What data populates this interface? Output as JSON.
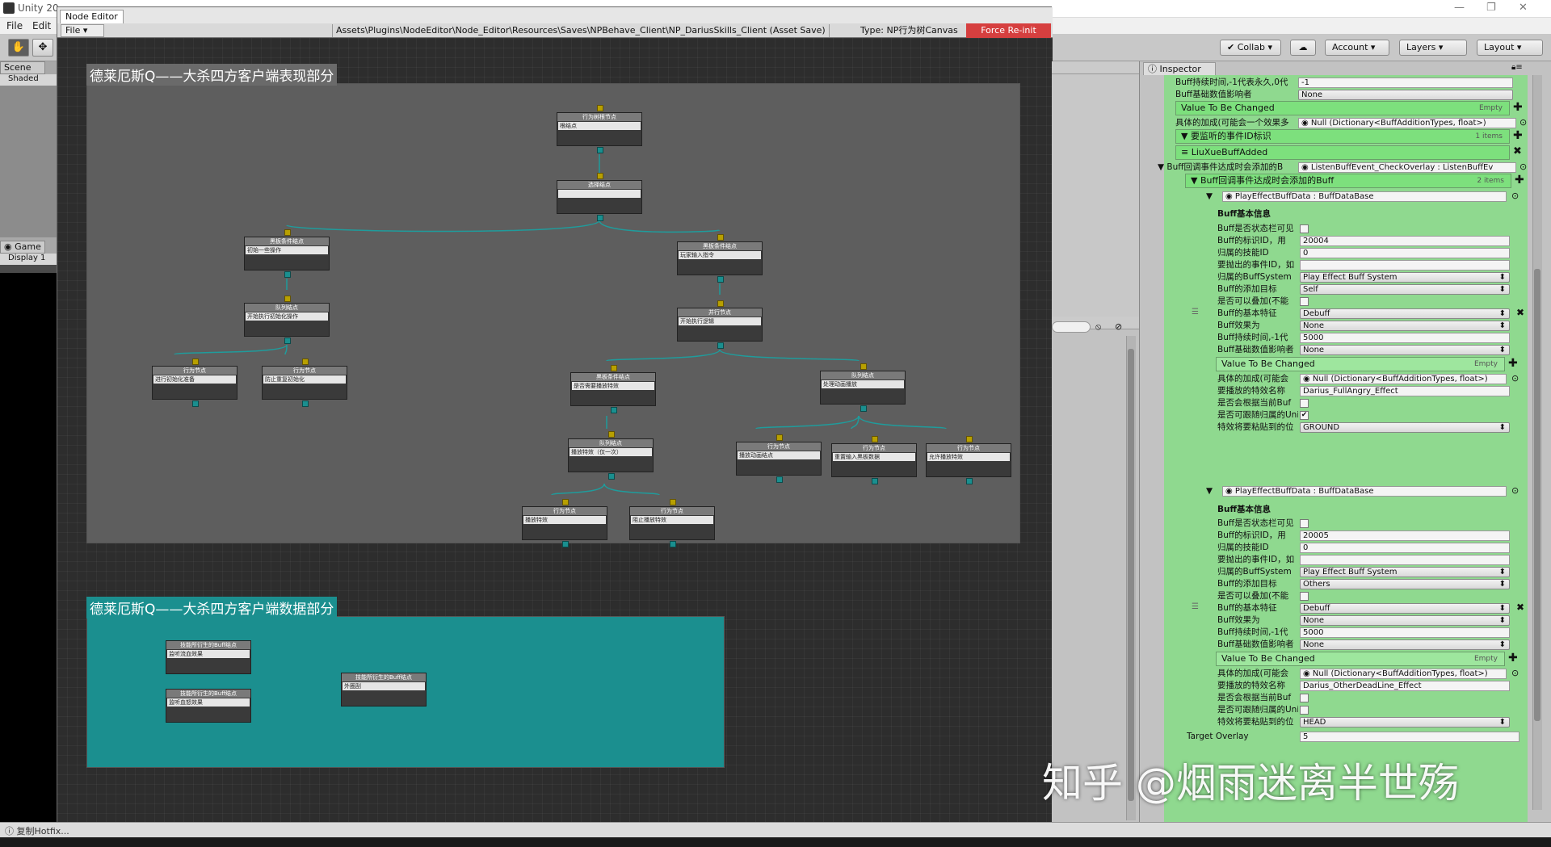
{
  "app": {
    "title": "Unity 20",
    "menu": [
      "File",
      "Edit"
    ]
  },
  "toolbar": {
    "collab": "Collab",
    "account": "Account",
    "layers": "Layers",
    "layout": "Layout"
  },
  "left": {
    "scene": "Scene",
    "shaded": "Shaded",
    "game": "Game",
    "display": "Display 1"
  },
  "editor": {
    "tab": "Node Editor",
    "file": "File",
    "path": "Assets\\Plugins\\NodeEditor\\Node_Editor\\Resources\\Saves\\NPBehave_Client\\NP_DariusSkills_Client (Asset Save)",
    "type": "Type: NP行为树Canvas",
    "force": "Force Re-init",
    "group1": "德莱厄斯Q——大杀四方客户端表现部分",
    "group2": "德莱厄斯Q——大杀四方客户端数据部分",
    "nodes": [
      {
        "h": "行为树根节点",
        "f": "根结点"
      },
      {
        "h": "选择结点",
        "f": ""
      },
      {
        "h": "黑板条件结点",
        "f": "初始一些操作"
      },
      {
        "h": "黑板条件结点",
        "f": "玩家输入指令"
      },
      {
        "h": "队列结点",
        "f": "开始执行初始化操作"
      },
      {
        "h": "并行节点",
        "f": "开始执行逻辑"
      },
      {
        "h": "行为节点",
        "f": "进行初始化准备"
      },
      {
        "h": "行为节点",
        "f": "防止重复初始化"
      },
      {
        "h": "黑板条件结点",
        "f": "是否需要播放特效"
      },
      {
        "h": "队列结点",
        "f": "处理动画播放"
      },
      {
        "h": "队列结点",
        "f": "播放特效（仅一次）"
      },
      {
        "h": "行为节点",
        "f": "播放动画结点"
      },
      {
        "h": "行为节点",
        "f": "重置输入黑板数据"
      },
      {
        "h": "行为节点",
        "f": "允许播放特效"
      },
      {
        "h": "行为节点",
        "f": "播放特效"
      },
      {
        "h": "行为节点",
        "f": "阻止播放特效"
      },
      {
        "h": "技能所衍生的Buff结点",
        "f": "监听流血效果"
      },
      {
        "h": "技能所衍生的Buff结点",
        "f": "监听血怒效果"
      },
      {
        "h": "技能所衍生的Buff结点",
        "f": "外圈刮"
      }
    ]
  },
  "inspector": {
    "tab": "Inspector",
    "r1": "Buff持续时间,-1代表永久,0代",
    "v1": "-1",
    "r2": "Buff基础数值影响者",
    "v2": "None",
    "vtbc": "Value To Be Changed",
    "empty": "Empty",
    "r3": "具体的加成(可能会一个效果多",
    "v3": "Null (Dictionary<BuffAdditionTypes, float>)",
    "evt": "要监听的事件ID标识",
    "items1": "1 items",
    "evtv": "LiuXueBuffAdded",
    "r4": "Buff回调事件达成时会添加的B",
    "v4": "ListenBuffEvent_CheckOverlay : ListenBuffEv",
    "list": "Buff回调事件达成时会添加的Buff",
    "items2": "2 items",
    "e1": "PlayEffectBuffData : BuffDataBase",
    "info": "Buff基本信息",
    "l1": "Buff是否状态栏可见",
    "l2": "Buff的标识ID，用",
    "l3": "归属的技能ID",
    "l4": "要抛出的事件ID，如",
    "l5": "归属的BuffSystem",
    "l6": "Buff的添加目标",
    "l7": "是否可以叠加(不能",
    "l8": "Buff的基本特征",
    "l9": "Buff效果为",
    "l10": "Buff持续时间,-1代",
    "l11": "Buff基础数值影响者",
    "l12": "具体的加成(可能会",
    "l13": "要播放的特效名称",
    "l14": "是否会根据当前Buf",
    "l15": "是否可跟随归属的Uni",
    "l16": "特效将要粘贴到的位",
    "a_id": "20004",
    "a_skill": "0",
    "a_sys": "Play Effect Buff System",
    "a_target": "Self",
    "a_feat": "Debuff",
    "a_eff": "None",
    "a_dur": "5000",
    "a_inf": "None",
    "a_add": "Null (Dictionary<BuffAdditionTypes, float>)",
    "a_fx": "Darius_FullAngry_Effect",
    "a_pos": "GROUND",
    "b_id": "20005",
    "b_skill": "0",
    "b_sys": "Play Effect Buff System",
    "b_target": "Others",
    "b_feat": "Debuff",
    "b_eff": "None",
    "b_dur": "5000",
    "b_inf": "None",
    "b_add": "Null (Dictionary<BuffAdditionTypes, float>)",
    "b_fx": "Darius_OtherDeadLine_Effect",
    "b_pos": "HEAD",
    "target_overlay": "Target Overlay",
    "target_overlay_v": "5"
  },
  "status": "复制Hotfix...",
  "watermark": "知乎 @烟雨迷离半世殇",
  "colors": {
    "force": "#d63f3f",
    "group_data": "#1b8f8f",
    "inspector_green": "#7de07d"
  }
}
